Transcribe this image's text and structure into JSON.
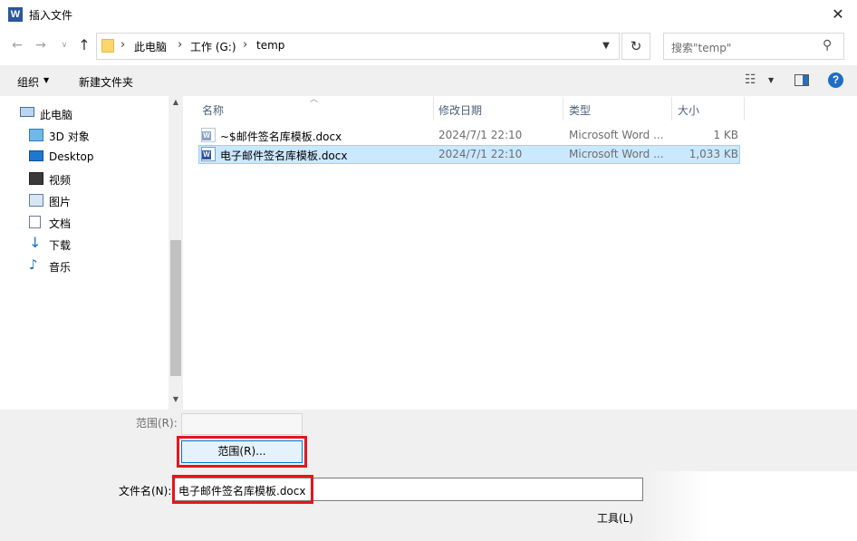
{
  "window": {
    "title": "插入文件",
    "app_icon": "word-icon",
    "close_label": "✕"
  },
  "nav": {
    "breadcrumb": [
      "此电脑",
      "工作 (G:)",
      "temp"
    ],
    "search_placeholder": "搜索\"temp\""
  },
  "toolbar": {
    "organize_label": "组织",
    "new_folder_label": "新建文件夹",
    "help_label": "?"
  },
  "sidebar": {
    "items": [
      {
        "label": "此电脑",
        "icon": "computer-icon"
      },
      {
        "label": "3D 对象",
        "icon": "3d-objects-icon"
      },
      {
        "label": "Desktop",
        "icon": "desktop-icon"
      },
      {
        "label": "视频",
        "icon": "video-icon"
      },
      {
        "label": "图片",
        "icon": "pictures-icon"
      },
      {
        "label": "文档",
        "icon": "documents-icon"
      },
      {
        "label": "下载",
        "icon": "download-icon"
      },
      {
        "label": "音乐",
        "icon": "music-icon"
      }
    ]
  },
  "file_list": {
    "columns": [
      "名称",
      "修改日期",
      "类型",
      "大小"
    ],
    "rows": [
      {
        "name": "~$邮件签名库模板.docx",
        "modified": "2024/7/1 22:10",
        "type": "Microsoft Word ...",
        "size": "1 KB",
        "selected": false
      },
      {
        "name": "电子邮件签名库模板.docx",
        "modified": "2024/7/1 22:10",
        "type": "Microsoft Word ...",
        "size": "1,033 KB",
        "selected": true
      }
    ]
  },
  "bottom": {
    "range_label": "范围(R):",
    "range_button": "范围(R)...",
    "filename_label": "文件名(N):",
    "filename_value": "电子邮件签名库模板.docx",
    "tools_label": "工具(L)"
  },
  "colors": {
    "accent": "#0078d7",
    "selection_bg": "#cce8ff",
    "highlight_frame": "#e8141c",
    "word_blue": "#2b579a"
  }
}
